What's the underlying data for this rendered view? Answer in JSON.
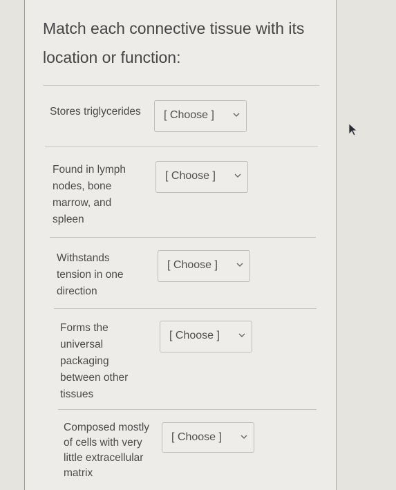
{
  "question": {
    "title": "Match each connective tissue with its location or function:"
  },
  "rows": [
    {
      "prompt": "Stores triglycerides",
      "select": {
        "value": "[ Choose ]"
      }
    },
    {
      "prompt": "Found in lymph nodes, bone marrow, and spleen",
      "select": {
        "value": "[ Choose ]"
      }
    },
    {
      "prompt": "Withstands tension in one direction",
      "select": {
        "value": "[ Choose ]"
      }
    },
    {
      "prompt": "Forms the universal packaging between other tissues",
      "select": {
        "value": "[ Choose ]"
      }
    },
    {
      "prompt": "Composed mostly of cells with very little extracellular matrix",
      "select": {
        "value": "[ Choose ]"
      }
    }
  ],
  "icons": {
    "dropdown": "chevron-down-icon",
    "pointer": "mouse-pointer-icon"
  }
}
